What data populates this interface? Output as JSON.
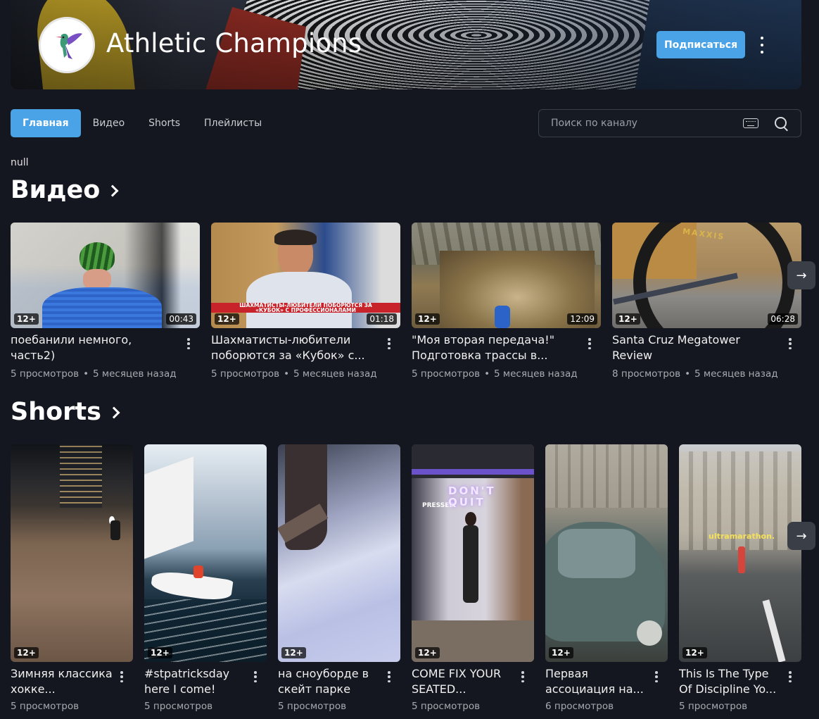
{
  "channel": {
    "name": "Athletic Champions",
    "subscribe_label": "Подписаться"
  },
  "tabs": [
    {
      "label": "Главная",
      "active": true
    },
    {
      "label": "Видео",
      "active": false
    },
    {
      "label": "Shorts",
      "active": false
    },
    {
      "label": "Плейлисты",
      "active": false
    }
  ],
  "search": {
    "placeholder": "Поиск по каналу"
  },
  "null_text": "null",
  "videos_section": {
    "title": "Видео",
    "items": [
      {
        "title": "поебанили немного, часть2)",
        "age_rating": "12+",
        "duration": "00:43",
        "views": "5 просмотров",
        "date": "5 месяцев назад"
      },
      {
        "title": "Шахматисты-любители поборются за «Кубок» с...",
        "age_rating": "12+",
        "duration": "01:18",
        "views": "5 просмотров",
        "date": "5 месяцев назад",
        "thumb_banner": "ШАХМАТИСТЫ-ЛЮБИТЕЛИ ПОБОРЮТСЯ ЗА «КУБОК» С ПРОФЕССИОНАЛАМИ"
      },
      {
        "title": "\"Моя вторая передача!\" Подготовка трассы в...",
        "age_rating": "12+",
        "duration": "12:09",
        "views": "5 просмотров",
        "date": "5 месяцев назад"
      },
      {
        "title": "Santa Cruz Megatower Review",
        "age_rating": "12+",
        "duration": "06:28",
        "views": "8 просмотров",
        "date": "5 месяцев назад",
        "thumb_text": "MAXXIS"
      }
    ]
  },
  "shorts_section": {
    "title": "Shorts",
    "items": [
      {
        "title": "Зимняя классика хокке...",
        "age_rating": "12+",
        "views": "5 просмотров"
      },
      {
        "title": "#stpatricksday here I come!",
        "age_rating": "12+",
        "views": "5 просмотров"
      },
      {
        "title": "на сноуборде в скейт парке",
        "age_rating": "12+",
        "views": "5 просмотров"
      },
      {
        "title": "COME FIX YOUR SEATED...",
        "age_rating": "12+",
        "views": "5 просмотров",
        "thumb_text_1": "PRESSED",
        "thumb_text_2": "DON'T QUIT"
      },
      {
        "title": "Первая ассоциация на...",
        "age_rating": "12+",
        "views": "6 просмотров"
      },
      {
        "title": "This Is The Type Of Discipline Yo...",
        "age_rating": "12+",
        "views": "5 просмотров",
        "thumb_text": "ultramarathon."
      }
    ]
  },
  "colors": {
    "accent": "#4aa3e6",
    "background": "#14171f"
  },
  "icons": {
    "next": "arrow-right-icon",
    "search": "search-icon",
    "keyboard": "keyboard-icon",
    "more": "more-vertical-icon",
    "avatar": "hummingbird-icon"
  }
}
